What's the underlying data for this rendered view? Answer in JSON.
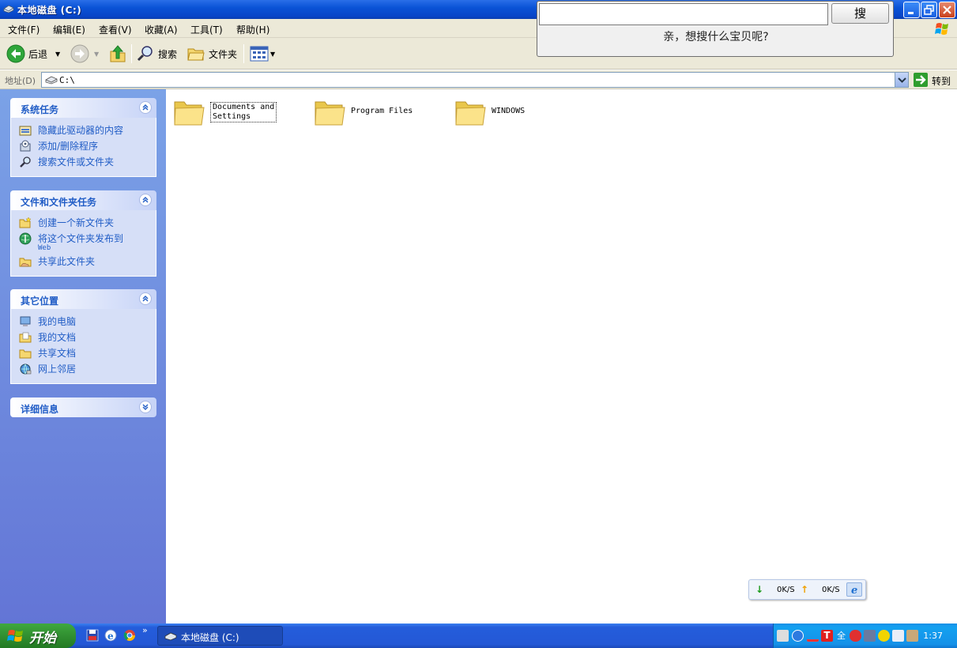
{
  "window": {
    "title": "本地磁盘 (C:)",
    "icon": "drive-icon"
  },
  "menu": [
    "文件(F)",
    "编辑(E)",
    "查看(V)",
    "收藏(A)",
    "工具(T)",
    "帮助(H)"
  ],
  "toolbar": {
    "back_label": "后退",
    "search_label": "搜索",
    "folders_label": "文件夹"
  },
  "address": {
    "label": "地址(D)",
    "path": "C:\\",
    "go_label": "转到"
  },
  "panels": [
    {
      "title": "系统任务",
      "items": [
        {
          "label": "隐藏此驱动器的内容",
          "icon": "hide-contents-icon"
        },
        {
          "label": "添加/删除程序",
          "icon": "add-remove-programs-icon"
        },
        {
          "label": "搜索文件或文件夹",
          "icon": "search-icon"
        }
      ]
    },
    {
      "title": "文件和文件夹任务",
      "items": [
        {
          "label": "创建一个新文件夹",
          "icon": "new-folder-icon"
        },
        {
          "label": "将这个文件夹发布到",
          "sub": "Web",
          "icon": "publish-web-icon"
        },
        {
          "label": "共享此文件夹",
          "icon": "share-folder-icon"
        }
      ]
    },
    {
      "title": "其它位置",
      "items": [
        {
          "label": "我的电脑",
          "icon": "my-computer-icon"
        },
        {
          "label": "我的文档",
          "icon": "my-documents-icon"
        },
        {
          "label": "共享文档",
          "icon": "shared-documents-icon"
        },
        {
          "label": "网上邻居",
          "icon": "network-places-icon"
        }
      ]
    },
    {
      "title": "详细信息",
      "items": []
    }
  ],
  "folders": [
    {
      "line1": "Documents and",
      "line2": "Settings",
      "selected": true
    },
    {
      "line1": "Program Files",
      "line2": "",
      "selected": false
    },
    {
      "line1": "WINDOWS",
      "line2": "",
      "selected": false
    }
  ],
  "speed": {
    "down": "0K/S",
    "up": "0K/S"
  },
  "search_popup": {
    "input_value": "",
    "button_label": "搜",
    "hint": "亲，想搜什么宝贝呢?"
  },
  "taskbar": {
    "start_label": "开始",
    "task_label": "本地磁盘 (C:)",
    "clock": "1:37",
    "more": "»"
  },
  "colors": {
    "titlebar": "#0a53d6",
    "panel_link": "#215dc6",
    "left_pane": "#6e8ddd",
    "taskbar": "#245ddb",
    "start_button": "#2e8b2e"
  }
}
